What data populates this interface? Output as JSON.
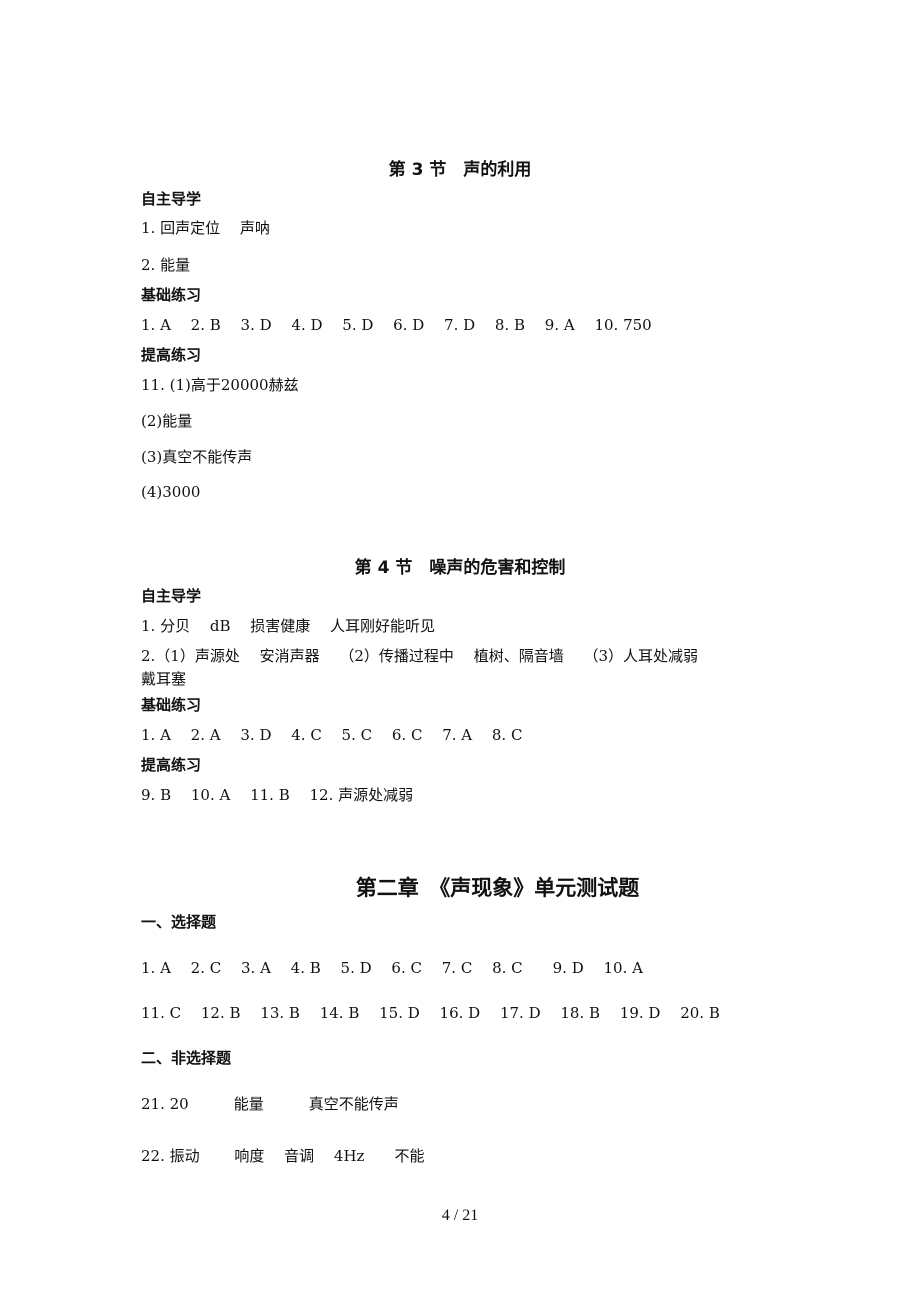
{
  "page": {
    "section3": {
      "title": "第 3 节　声的利用",
      "self_study_heading": "自主导学",
      "self_study_lines": [
        "1. 回声定位　 声呐",
        "2. 能量"
      ],
      "basic_heading": "基础练习",
      "basic_line": "1. A　 2. B　 3. D　 4. D　 5. D　 6. D　 7. D　 8. B　 9. A　 10. 750",
      "advanced_heading": "提高练习",
      "advanced_lines": [
        "11. (1)高于20000赫兹",
        "(2)能量",
        "(3)真空不能传声",
        "(4)3000"
      ]
    },
    "section4": {
      "title": "第 4 节　噪声的危害和控制",
      "self_study_heading": "自主导学",
      "self_study_lines": [
        "1. 分贝　 dB　 损害健康　 人耳刚好能听见",
        "2.（1）声源处　 安消声器　 （2）传播过程中　 植树、隔音墙　 （3）人耳处减弱",
        "戴耳塞"
      ],
      "basic_heading": "基础练习",
      "basic_line": "1. A　 2. A　 3. D　 4. C　 5. C　 6. C　 7. A　 8. C",
      "advanced_heading": "提高练习",
      "advanced_line": "9. B　 10. A　 11. B　 12. 声源处减弱"
    },
    "chapter_test": {
      "title": "第二章　《声现象》单元测试题",
      "part1_heading": "一、选择题",
      "part1_lines": [
        "1. A　 2. C　 3. A　 4. B　 5. D　 6. C　 7. C　 8. C　　9. D　 10. A",
        "11. C　 12. B　 13. B　 14. B　 15. D　 16. D　 17. D　 18. B　 19. D　 20. B"
      ],
      "part2_heading": "二、非选择题",
      "part2_lines": [
        "21. 20　　　能量　　　真空不能传声",
        "22. 振动　　 响度　 音调　 4Hz　　不能"
      ]
    },
    "page_number": "4 / 21"
  }
}
